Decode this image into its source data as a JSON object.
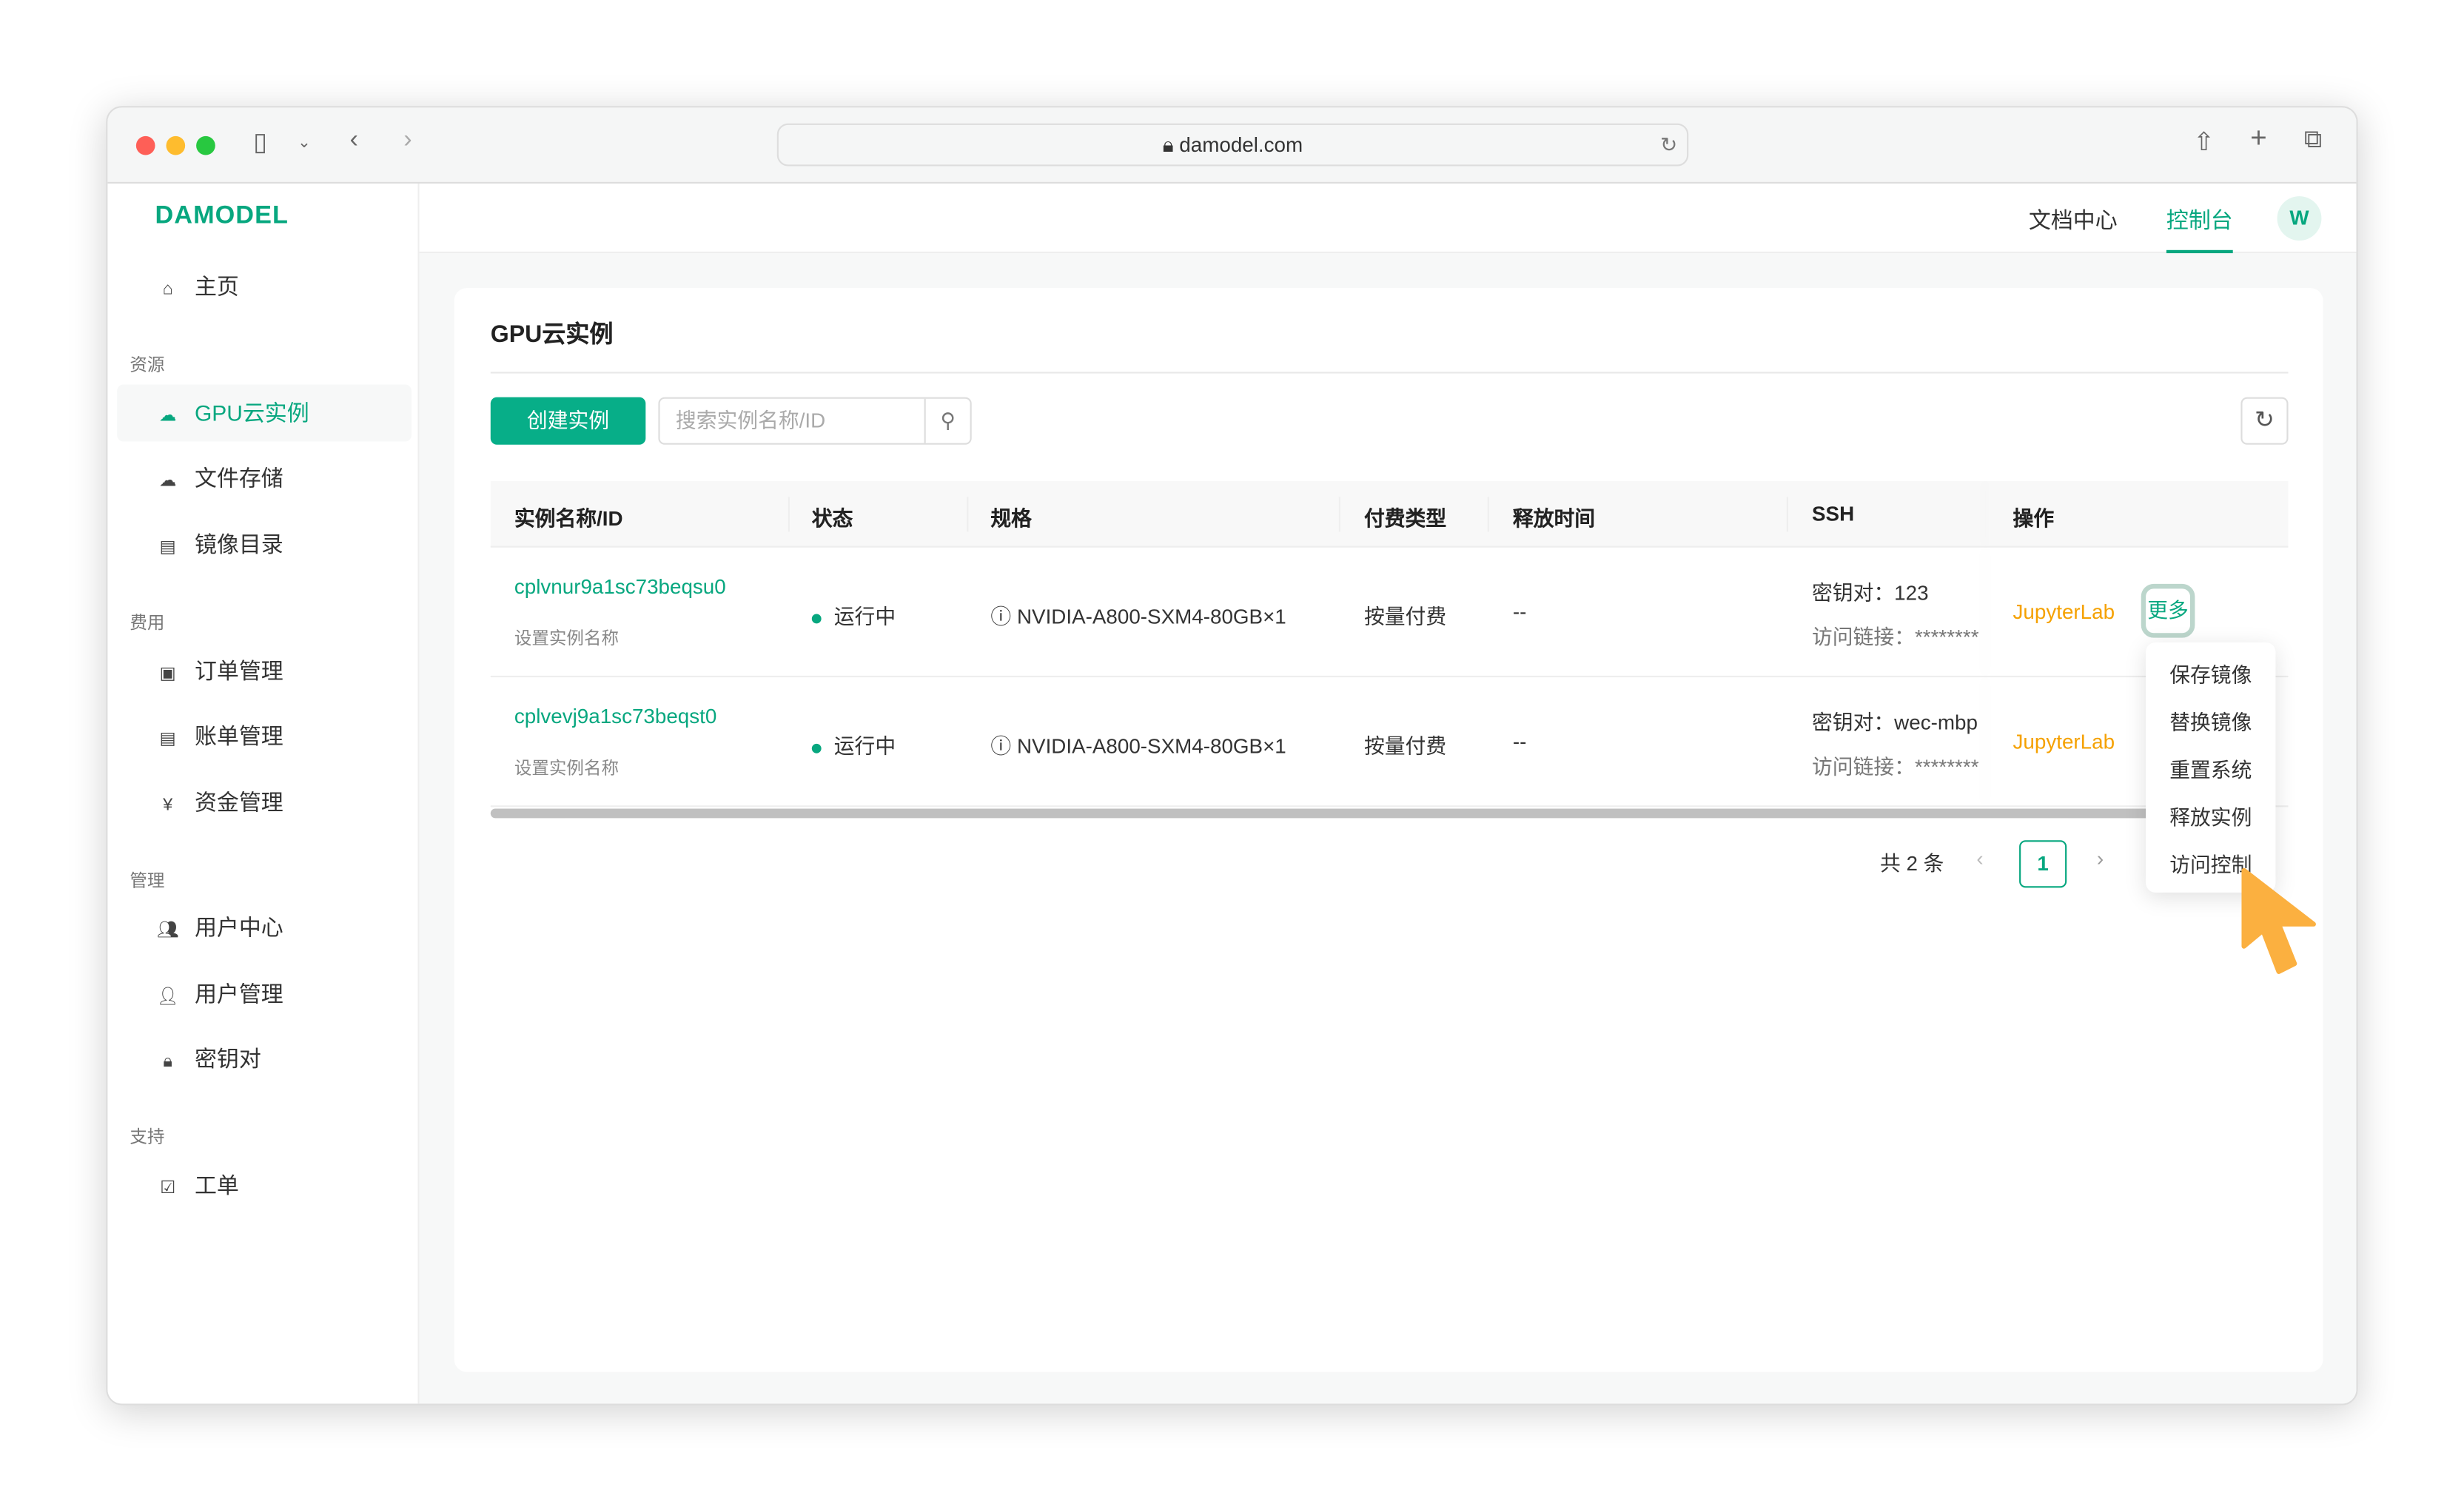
{
  "browser": {
    "url": "damodel.com"
  },
  "brand": "DAMODEL",
  "sidebar": {
    "home": "主页",
    "groups": [
      {
        "label": "资源",
        "items": [
          {
            "label": "GPU云实例",
            "icon": "cloud-gpu-icon",
            "active": true
          },
          {
            "label": "文件存储",
            "icon": "cloud-upload-icon"
          },
          {
            "label": "镜像目录",
            "icon": "book-icon"
          }
        ]
      },
      {
        "label": "费用",
        "items": [
          {
            "label": "订单管理",
            "icon": "order-icon"
          },
          {
            "label": "账单管理",
            "icon": "bill-icon"
          },
          {
            "label": "资金管理",
            "icon": "yen-icon"
          }
        ]
      },
      {
        "label": "管理",
        "items": [
          {
            "label": "用户中心",
            "icon": "users-icon"
          },
          {
            "label": "用户管理",
            "icon": "user-gear-icon"
          },
          {
            "label": "密钥对",
            "icon": "lock-icon"
          }
        ]
      },
      {
        "label": "支持",
        "items": [
          {
            "label": "工单",
            "icon": "checkbox-icon"
          }
        ]
      }
    ]
  },
  "topnav": {
    "docs": "文档中心",
    "console": "控制台",
    "avatar": "W"
  },
  "page": {
    "title": "GPU云实例",
    "create_label": "创建实例",
    "search_placeholder": "搜索实例名称/ID",
    "columns": [
      "实例名称/ID",
      "状态",
      "规格",
      "付费类型",
      "释放时间",
      "SSH",
      "操作"
    ],
    "rows": [
      {
        "id": "cplvnur9a1sc73beqsu0",
        "name_hint": "设置实例名称",
        "status": "运行中",
        "spec": "NVIDIA-A800-SXM4-80GB×1",
        "billing": "按量付费",
        "release": "--",
        "keypair": "密钥对：123",
        "access": "访问链接：********",
        "action": "JupyterLab",
        "more": "更多"
      },
      {
        "id": "cplvevj9a1sc73beqst0",
        "name_hint": "设置实例名称",
        "status": "运行中",
        "spec": "NVIDIA-A800-SXM4-80GB×1",
        "billing": "按量付费",
        "release": "--",
        "keypair": "密钥对：wec-mbp",
        "access": "访问链接：********",
        "action": "JupyterLab"
      }
    ],
    "total": "共 2 条",
    "current_page": "1",
    "more_menu": [
      "保存镜像",
      "替换镜像",
      "重置系统",
      "释放实例",
      "访问控制"
    ]
  },
  "colors": {
    "accent": "#07a77f",
    "link_orange": "#f5a100",
    "cursor": "#fbb040"
  }
}
